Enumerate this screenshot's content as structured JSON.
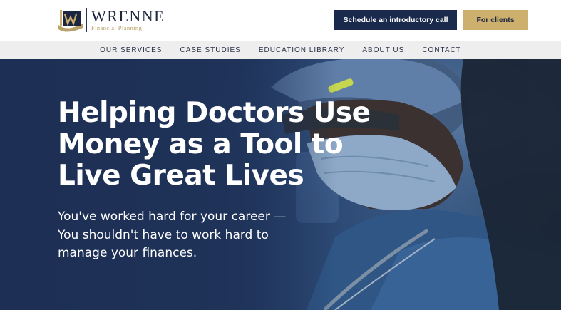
{
  "brand": {
    "name": "WRENNE",
    "subtitle": "Financial Planning",
    "colors": {
      "navy": "#1a2a4c",
      "gold": "#cdb06e"
    }
  },
  "header": {
    "cta_primary": "Schedule an introductory call",
    "cta_secondary": "For clients"
  },
  "nav": {
    "items": [
      "OUR SERVICES",
      "CASE STUDIES",
      "EDUCATION LIBRARY",
      "ABOUT US",
      "CONTACT"
    ]
  },
  "hero": {
    "title": "Helping Doctors Use Money as a Tool to Live Great Lives",
    "subtitle": "You've worked hard for your career —You shouldn't have to work hard to manage your finances.",
    "image": "surgeon-in-mask-photo"
  }
}
